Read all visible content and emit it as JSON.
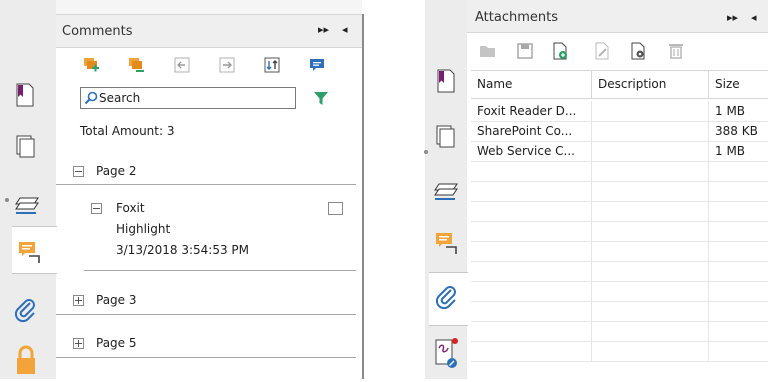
{
  "comments_panel": {
    "title": "Comments",
    "expand_glyph": "▸▸",
    "collapse_glyph": "◂",
    "toolbar": {
      "icons": [
        "add-comment-icon",
        "remove-comment-icon",
        "previous-icon",
        "next-icon",
        "sort-icon",
        "comment-bubble-icon"
      ]
    },
    "search": {
      "placeholder": "Search"
    },
    "filter_icon": "filter-icon",
    "total_label": "Total Amount: 3",
    "pages": [
      {
        "label": "Page 2",
        "expanded": true,
        "items": [
          {
            "author": "Foxit",
            "type": "Highlight",
            "date": "3/13/2018 3:54:53 PM"
          }
        ]
      },
      {
        "label": "Page 3",
        "expanded": false,
        "items": []
      },
      {
        "label": "Page 5",
        "expanded": false,
        "items": []
      }
    ],
    "side_tabs": [
      "bookmark-icon",
      "pages-icon",
      "layers-icon",
      "comments-icon",
      "attachments-icon",
      "security-icon"
    ]
  },
  "attachments_panel": {
    "title": "Attachments",
    "expand_glyph": "▸▸",
    "collapse_glyph": "◂",
    "toolbar": {
      "icons": [
        "open-folder-icon",
        "save-icon",
        "add-file-icon",
        "edit-description-icon",
        "file-settings-icon",
        "delete-icon"
      ]
    },
    "columns": [
      "Name",
      "Description",
      "Size"
    ],
    "rows": [
      {
        "name": "Foxit Reader D...",
        "description": "",
        "size": "1 MB"
      },
      {
        "name": "SharePoint Co...",
        "description": "",
        "size": "388 KB"
      },
      {
        "name": "Web Service C...",
        "description": "",
        "size": "1 MB"
      }
    ],
    "side_tabs": [
      "bookmark-icon",
      "pages-icon",
      "layers-icon",
      "comments-icon",
      "attachments-icon",
      "signature-icon"
    ]
  },
  "colors": {
    "accent_blue": "#2d6fb8",
    "comment_orange": "#f1a43a",
    "filter_green": "#2e9e6a",
    "bookmark_purple": "#7a1f6e"
  }
}
